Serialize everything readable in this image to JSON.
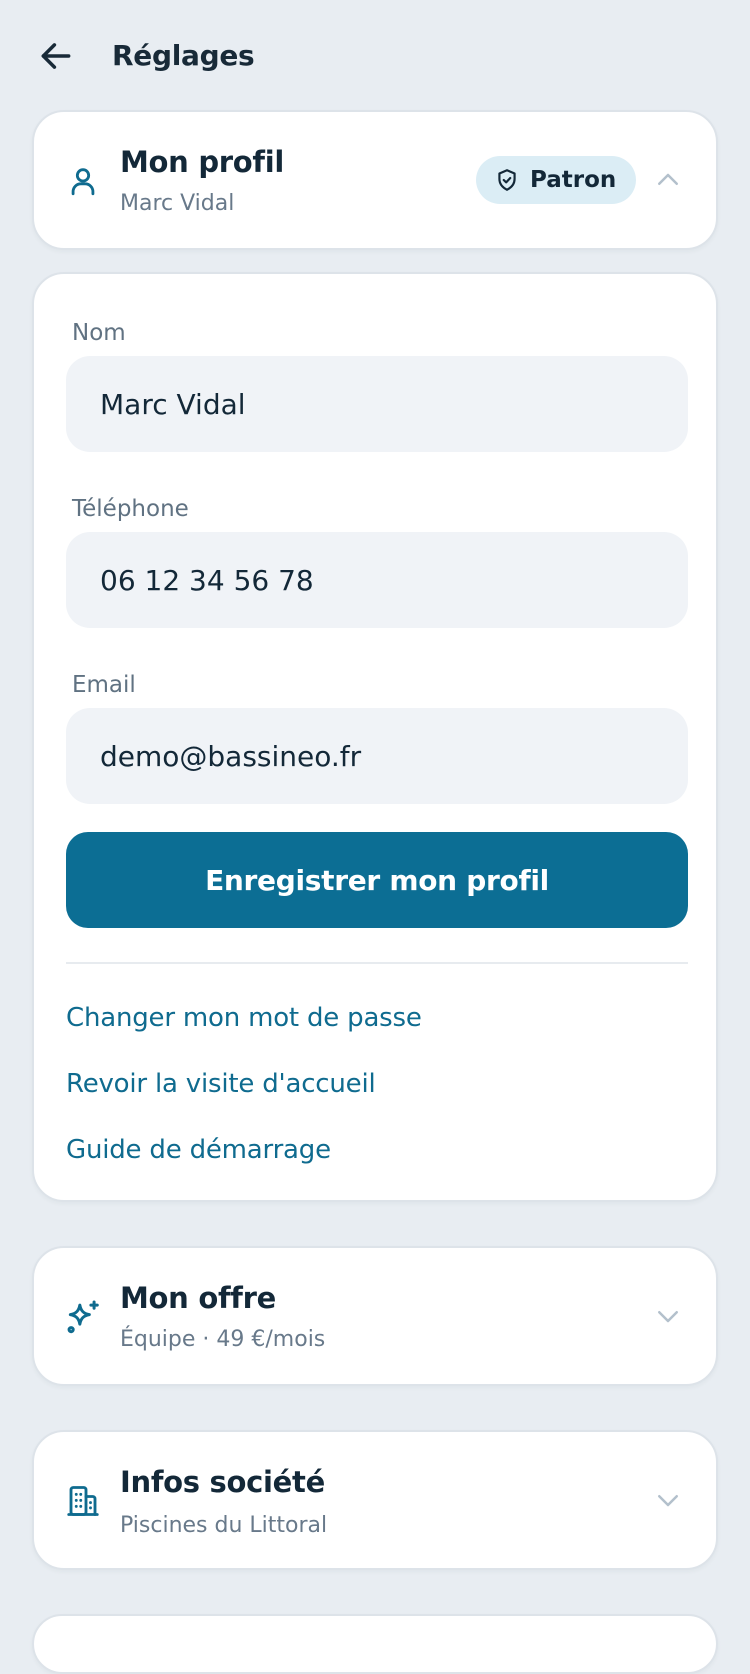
{
  "header": {
    "title": "Réglages"
  },
  "profile": {
    "title": "Mon profil",
    "subtitle": "Marc Vidal",
    "role_badge": "Patron",
    "form": {
      "name_label": "Nom",
      "name_value": "Marc Vidal",
      "phone_label": "Téléphone",
      "phone_value": "06 12 34 56 78",
      "email_label": "Email",
      "email_value": "demo@bassineo.fr",
      "save_label": "Enregistrer mon profil"
    },
    "links": [
      "Changer mon mot de passe",
      "Revoir la visite d'accueil",
      "Guide de démarrage"
    ]
  },
  "offer": {
    "title": "Mon offre",
    "subtitle": "Équipe · 49 €/mois"
  },
  "company": {
    "title": "Infos société",
    "subtitle": "Piscines du Littoral"
  },
  "icons": {
    "back": "arrow-left-icon",
    "profile": "user-icon",
    "badge": "shield-check-icon",
    "offer": "sparkles-icon",
    "company": "building-icon",
    "expanded": "chevron-up-icon",
    "collapsed": "chevron-down-icon"
  },
  "colors": {
    "background": "#e8edf2",
    "accent": "#0c6e94",
    "badge_bg": "#dbedf5",
    "input_bg": "#f0f3f7",
    "text_primary": "#132838",
    "text_secondary": "#68798a"
  }
}
